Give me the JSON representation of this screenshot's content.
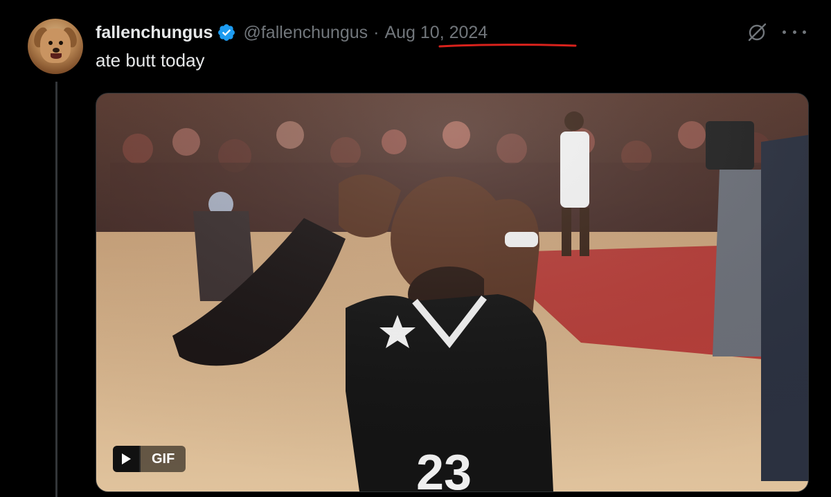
{
  "tweet": {
    "display_name": "fallenchungus",
    "handle": "@fallenchungus",
    "separator": "·",
    "date": "Aug 10, 2024",
    "text": "ate butt today",
    "verified": true,
    "media": {
      "type": "gif",
      "badge_label": "GIF",
      "jersey_number": "23"
    }
  },
  "icons": {
    "avatar": "dog-avatar",
    "verified": "verified-badge-icon",
    "grok": "grok-icon",
    "more": "more-icon",
    "play": "play-icon"
  },
  "colors": {
    "background": "#000000",
    "text_primary": "#e7e9ea",
    "text_secondary": "#71767b",
    "verified_blue": "#1d9bf0",
    "annotation_red": "#d9221c"
  }
}
